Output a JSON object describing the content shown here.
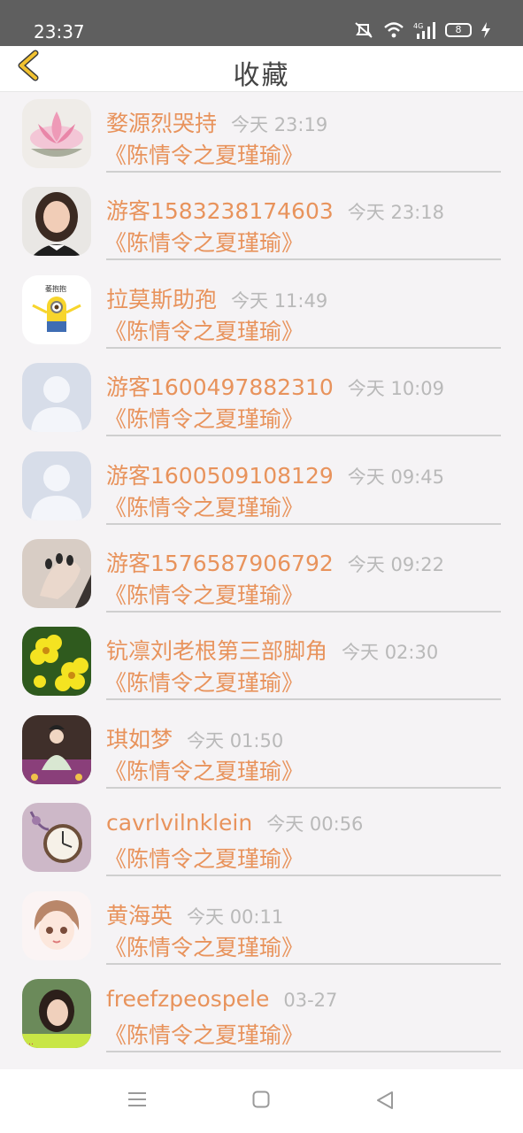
{
  "status_bar": {
    "time": "23:37",
    "network": "4G",
    "battery": "8"
  },
  "header": {
    "title": "收藏"
  },
  "favorites": [
    {
      "name": "婺源烈哭持",
      "time": "今天 23:19",
      "book": "《陈情令之夏瑾瑜》",
      "avatar": "lotus-painting-icon"
    },
    {
      "name": "游客1583238174603",
      "time": "今天 23:18",
      "book": "《陈情令之夏瑾瑜》",
      "avatar": "girl-photo-icon"
    },
    {
      "name": "拉莫斯助孢",
      "time": "今天 11:49",
      "book": "《陈情令之夏瑾瑜》",
      "avatar": "minion-icon"
    },
    {
      "name": "游客1600497882310",
      "time": "今天 10:09",
      "book": "《陈情令之夏瑾瑜》",
      "avatar": "default-user-icon"
    },
    {
      "name": "游客1600509108129",
      "time": "今天 09:45",
      "book": "《陈情令之夏瑾瑜》",
      "avatar": "default-user-icon"
    },
    {
      "name": "游客1576587906792",
      "time": "今天 09:22",
      "book": "《陈情令之夏瑾瑜》",
      "avatar": "hand-photo-icon"
    },
    {
      "name": "钪凛刘老根第三部脚角",
      "time": "今天 02:30",
      "book": "《陈情令之夏瑾瑜》",
      "avatar": "yellow-flowers-icon"
    },
    {
      "name": "琪如梦",
      "time": "今天 01:50",
      "book": "《陈情令之夏瑾瑜》",
      "avatar": "costume-figure-icon"
    },
    {
      "name": "cavrlvilnklein",
      "time": "今天 00:56",
      "book": "《陈情令之夏瑾瑜》",
      "avatar": "pocket-watch-icon"
    },
    {
      "name": "黄海英",
      "time": "今天 00:11",
      "book": "《陈情令之夏瑾瑜》",
      "avatar": "anime-girl-icon"
    },
    {
      "name": "freefzpeospele",
      "time": "03-27",
      "book": "《陈情令之夏瑾瑜》",
      "avatar": "woman-photo-icon"
    }
  ],
  "colors": {
    "accent": "#e8935c",
    "time_gray": "#b9b9b9",
    "back_arrow": "#f2c230",
    "status_bar": "#5f5f5f"
  },
  "nav_bar": {
    "menu": "menu-icon",
    "home": "home-square-icon",
    "back": "back-triangle-icon"
  }
}
